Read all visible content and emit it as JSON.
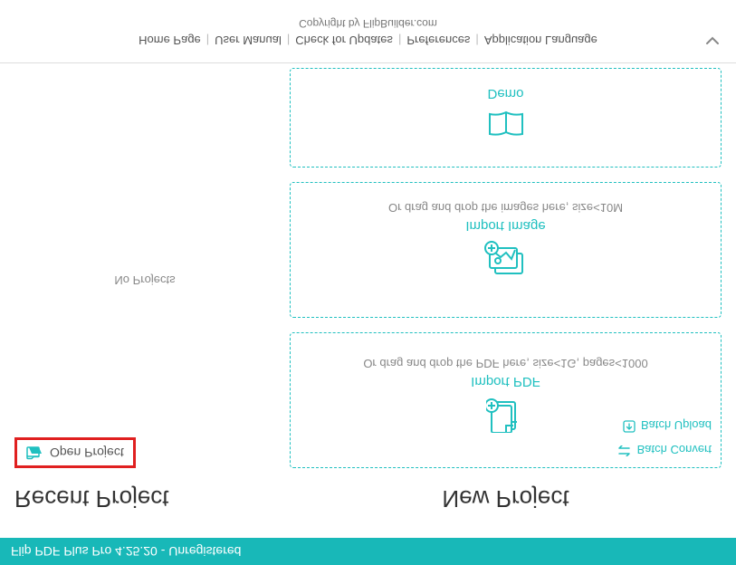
{
  "titlebar": {
    "title": "Flip PDF Plus Pro 4.25.20 - Unregistered"
  },
  "recent": {
    "heading": "Recent Project",
    "open_label": "Open Project",
    "no_projects": "No Projects"
  },
  "newproject": {
    "heading": "New Project",
    "pdf": {
      "title": "Import PDF",
      "sub": "Or drag and drop the PDF here, size<1G, pages<1000",
      "batch_convert": "Batch Convert",
      "batch_upload": "Batch Upload"
    },
    "image": {
      "title": "Import Image",
      "sub": "Or drag and drop the images here, size<10M"
    },
    "demo": {
      "title": "Demo"
    }
  },
  "footer": {
    "links": {
      "home": "Home Page",
      "manual": "User Manual",
      "updates": "Check for Updates",
      "prefs": "Preferences",
      "lang": "Application Language"
    },
    "copyright": "Copyright by FlipBuilder.com"
  }
}
